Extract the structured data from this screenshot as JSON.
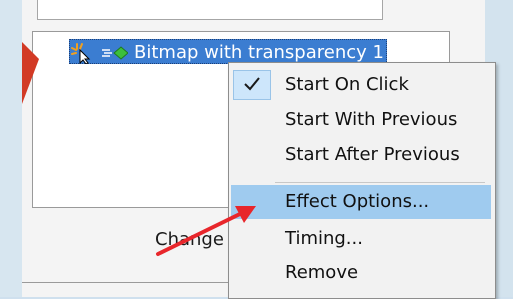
{
  "list": {
    "item_label": "Bitmap with transparency 1"
  },
  "bottom_button": {
    "label": "Change"
  },
  "context_menu": {
    "items": [
      {
        "label": "Start On Click",
        "checked": true,
        "highlighted": false
      },
      {
        "label": "Start With Previous",
        "checked": false,
        "highlighted": false
      },
      {
        "label": "Start After Previous",
        "checked": false,
        "highlighted": false
      },
      {
        "label": "Effect Options...",
        "checked": false,
        "highlighted": true
      },
      {
        "label": "Timing...",
        "checked": false,
        "highlighted": false
      },
      {
        "label": "Remove",
        "checked": false,
        "highlighted": false
      }
    ]
  },
  "colors": {
    "selection": "#3b7dd1",
    "menu_highlight": "#9fcbef",
    "annotation_arrow": "#d23a25",
    "pointer_arrow": "#e8262b"
  },
  "icons": {
    "list_item_cursor": "mouse-click-icon",
    "list_item_effect": "motion-path-icon",
    "check": "check-icon"
  }
}
